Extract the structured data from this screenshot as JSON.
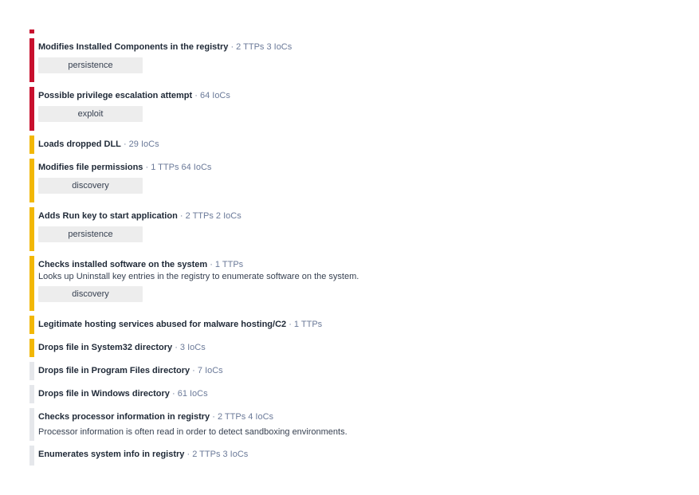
{
  "signatures": [
    {
      "title": "Modifies Installed Components in the registry",
      "meta": "· 2 TTPs 3 IoCs",
      "severity": "high",
      "tag": "persistence"
    },
    {
      "title": "Possible privilege escalation attempt",
      "meta": "· 64 IoCs",
      "severity": "high",
      "tag": "exploit"
    },
    {
      "title": "Loads dropped DLL",
      "meta": "· 29 IoCs",
      "severity": "medium"
    },
    {
      "title": "Modifies file permissions",
      "meta": "· 1 TTPs 64 IoCs",
      "severity": "medium",
      "tag": "discovery"
    },
    {
      "title": "Adds Run key to start application",
      "meta": "· 2 TTPs 2 IoCs",
      "severity": "medium",
      "tag": "persistence"
    },
    {
      "title": "Checks installed software on the system",
      "meta": "· 1 TTPs",
      "severity": "medium",
      "description": "Looks up Uninstall key entries in the registry to enumerate software on the system.",
      "tag": "discovery"
    },
    {
      "title": "Legitimate hosting services abused for malware hosting/C2",
      "meta": "· 1 TTPs",
      "severity": "medium"
    },
    {
      "title": "Drops file in System32 directory",
      "meta": "· 3 IoCs",
      "severity": "medium"
    },
    {
      "title": "Drops file in Program Files directory",
      "meta": "· 7 IoCs",
      "severity": "low"
    },
    {
      "title": "Drops file in Windows directory",
      "meta": "· 61 IoCs",
      "severity": "low"
    },
    {
      "title": "Checks processor information in registry",
      "meta": "· 2 TTPs 4 IoCs",
      "severity": "low",
      "description": "Processor information is often read in order to detect sandboxing environments."
    },
    {
      "title": "Enumerates system info in registry",
      "meta": "· 2 TTPs 3 IoCs",
      "severity": "low"
    }
  ],
  "severity_colors": {
    "high": "#c8102e",
    "medium": "#f2b705",
    "low": "#e5e7eb"
  }
}
